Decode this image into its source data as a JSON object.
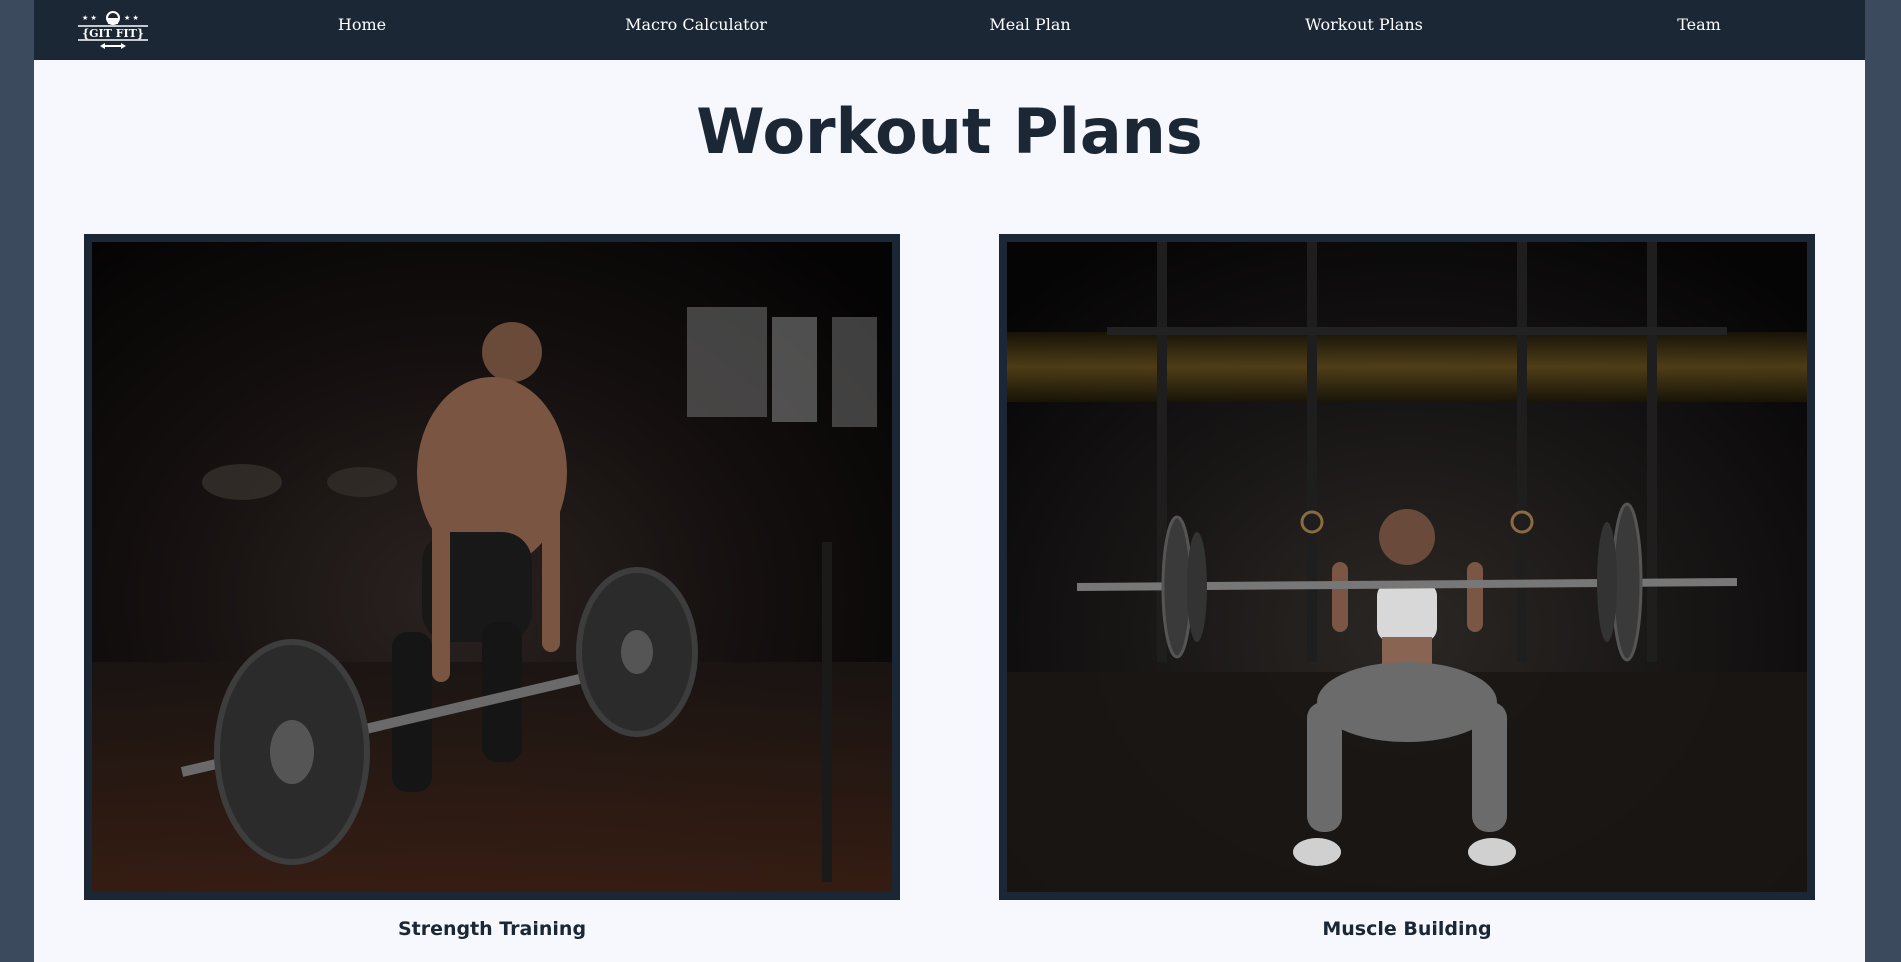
{
  "navbar": {
    "logo_text": "{GIT FIT}",
    "items": [
      {
        "label": "Home"
      },
      {
        "label": "Macro Calculator"
      },
      {
        "label": "Meal Plan"
      },
      {
        "label": "Workout Plans"
      },
      {
        "label": "Team"
      }
    ]
  },
  "main": {
    "title": "Workout Plans",
    "cards": [
      {
        "title": "Strength Training"
      },
      {
        "title": "Muscle Building"
      }
    ]
  },
  "colors": {
    "navbar_bg": "#1c2735",
    "page_bg": "#f6f8fd",
    "outer_bg": "#3b4a5c",
    "title_text": "#1c2735"
  }
}
